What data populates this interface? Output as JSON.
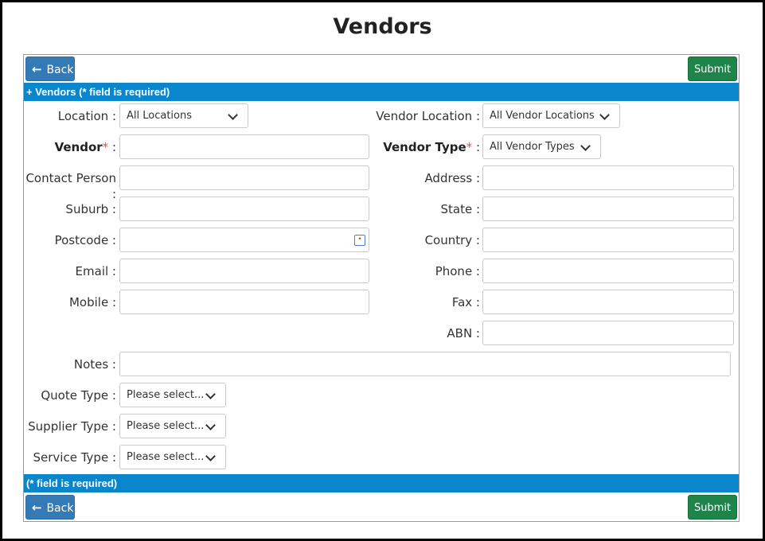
{
  "page": {
    "title": "Vendors"
  },
  "toolbar": {
    "back_label": "Back",
    "submit_label": "Submit"
  },
  "bars": {
    "top": "+ Vendors (* field is required)",
    "bottom": "(* field is required)"
  },
  "form": {
    "location": {
      "label": "Location :",
      "value": "All Locations"
    },
    "vendor_location": {
      "label": "Vendor Location :",
      "value": "All Vendor Locations"
    },
    "vendor": {
      "label": "Vendor",
      "suffix": " :",
      "required": "*"
    },
    "vendor_type": {
      "label": "Vendor Type",
      "suffix": " :",
      "required": "*",
      "value": "All Vendor Types"
    },
    "contact_person": {
      "label": "Contact Person :"
    },
    "address": {
      "label": "Address :"
    },
    "suburb": {
      "label": "Suburb :"
    },
    "state": {
      "label": "State :"
    },
    "postcode": {
      "label": "Postcode :"
    },
    "country": {
      "label": "Country :"
    },
    "email": {
      "label": "Email :"
    },
    "phone": {
      "label": "Phone :"
    },
    "mobile": {
      "label": "Mobile :"
    },
    "fax": {
      "label": "Fax :"
    },
    "abn": {
      "label": "ABN :"
    },
    "notes": {
      "label": "Notes :"
    },
    "quote_type": {
      "label": "Quote Type :",
      "value": "Please select..."
    },
    "supplier_type": {
      "label": "Supplier Type :",
      "value": "Please select..."
    },
    "service_type": {
      "label": "Service Type :",
      "value": "Please select..."
    }
  },
  "icons": {
    "back": "arrow-left-icon",
    "dropdown": "chevron-down-icon",
    "postcode": "address-card-icon"
  },
  "colors": {
    "primary": "#337ab7",
    "success": "#1e8449",
    "bar": "#0a87cc",
    "required": "#d9534f"
  }
}
